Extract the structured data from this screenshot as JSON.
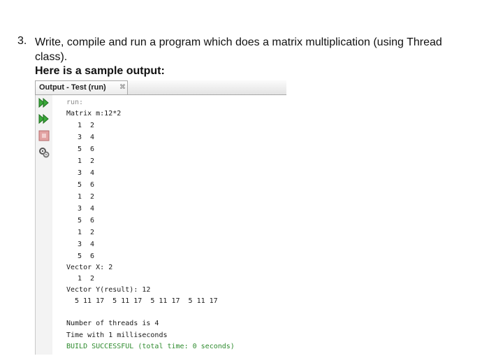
{
  "question": {
    "number": "3.",
    "text": "Write, compile and run a program which does a matrix multiplication (using Thread class).",
    "sample_heading": "Here is a sample output:"
  },
  "output_window": {
    "tab_title": "Output - Test (run)",
    "close_glyph": "⌘",
    "toolbar_icons": [
      "rerun-icon",
      "rerun-with-params-icon",
      "stop-icon",
      "settings-icon"
    ],
    "console_lines": {
      "run": "run:",
      "matrix_header": "Matrix m:12*2",
      "matrix_rows": [
        "1  2",
        "3  4",
        "5  6",
        "1  2",
        "3  4",
        "5  6",
        "1  2",
        "3  4",
        "5  6",
        "1  2",
        "3  4",
        "5  6"
      ],
      "vector_x_header": "Vector X: 2",
      "vector_x_values": "1  2",
      "vector_y_header": "Vector Y(result): 12",
      "vector_y_values": "5 11 17  5 11 17  5 11 17  5 11 17",
      "threads": "Number of threads is 4",
      "time": "Time with 1 milliseconds",
      "build": "BUILD SUCCESSFUL (total time: 0 seconds)"
    }
  }
}
